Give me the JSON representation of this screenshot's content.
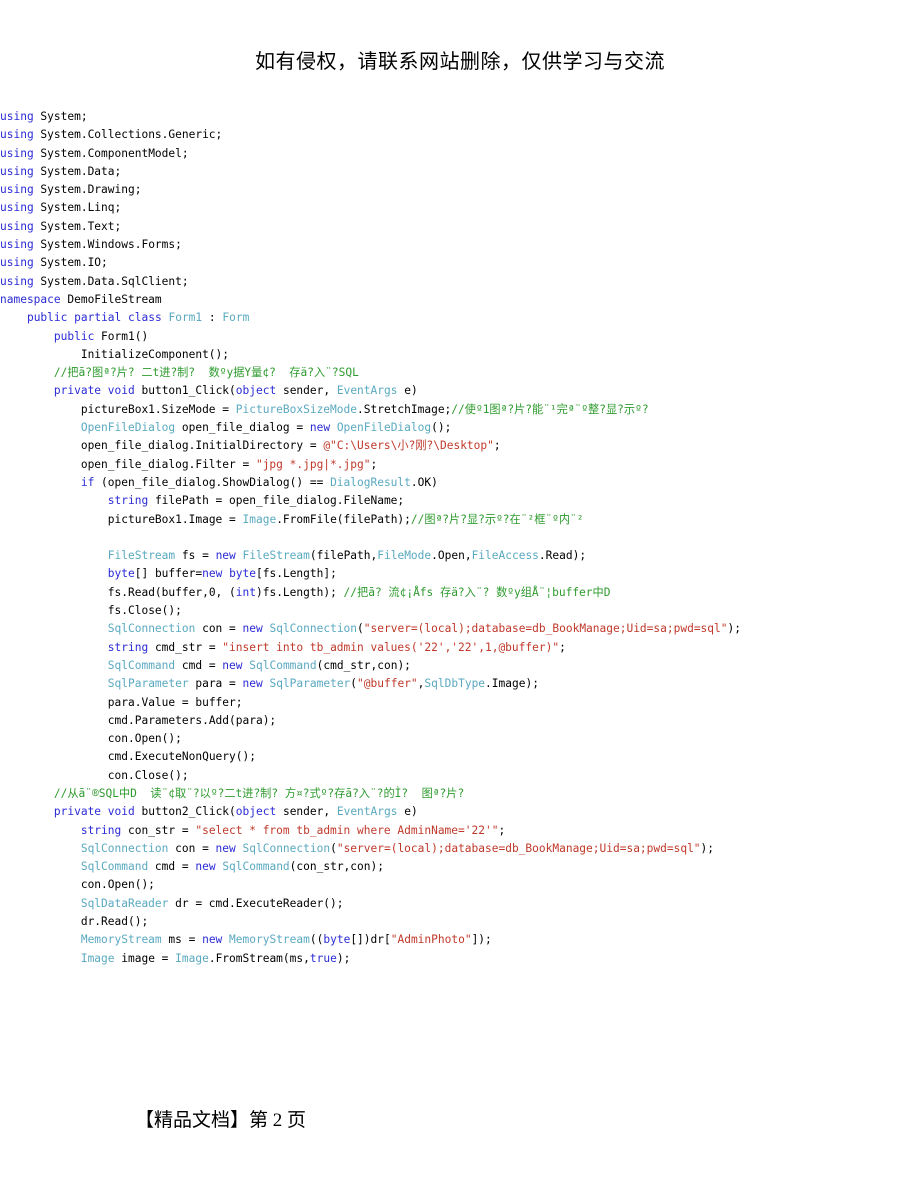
{
  "header": {
    "notice": "如有侵权，请联系网站删除，仅供学习与交流"
  },
  "footer": {
    "text": "【精品文档】第 2 页",
    "label": "【精品文档】",
    "page_prefix": "第",
    "page_number": "2",
    "page_suffix": "页"
  },
  "colors": {
    "keyword": "#2b2bd6",
    "type": "#5aa9c0",
    "string": "#c0392b",
    "comment": "#2e9b2e",
    "plain": "#000000",
    "background": "#ffffff"
  },
  "code": {
    "language": "C#",
    "lines": [
      {
        "id": "l1",
        "indent": "",
        "tokens": [
          {
            "t": "using",
            "c": "kw"
          },
          {
            "t": " System;",
            "c": "pln"
          }
        ]
      },
      {
        "id": "l2",
        "indent": "",
        "tokens": [
          {
            "t": "using",
            "c": "kw"
          },
          {
            "t": " System.Collections.Generic;",
            "c": "pln"
          }
        ]
      },
      {
        "id": "l3",
        "indent": "",
        "tokens": [
          {
            "t": "using",
            "c": "kw"
          },
          {
            "t": " System.ComponentModel;",
            "c": "pln"
          }
        ]
      },
      {
        "id": "l4",
        "indent": "",
        "tokens": [
          {
            "t": "using",
            "c": "kw"
          },
          {
            "t": " System.Data;",
            "c": "pln"
          }
        ]
      },
      {
        "id": "l5",
        "indent": "",
        "tokens": [
          {
            "t": "using",
            "c": "kw"
          },
          {
            "t": " System.Drawing;",
            "c": "pln"
          }
        ]
      },
      {
        "id": "l6",
        "indent": "",
        "tokens": [
          {
            "t": "using",
            "c": "kw"
          },
          {
            "t": " System.Linq;",
            "c": "pln"
          }
        ]
      },
      {
        "id": "l7",
        "indent": "",
        "tokens": [
          {
            "t": "using",
            "c": "kw"
          },
          {
            "t": " System.Text;",
            "c": "pln"
          }
        ]
      },
      {
        "id": "l8",
        "indent": "",
        "tokens": [
          {
            "t": "using",
            "c": "kw"
          },
          {
            "t": " System.Windows.Forms;",
            "c": "pln"
          }
        ]
      },
      {
        "id": "l9",
        "indent": "",
        "tokens": [
          {
            "t": "using",
            "c": "kw"
          },
          {
            "t": " System.IO;",
            "c": "pln"
          }
        ]
      },
      {
        "id": "l10",
        "indent": "",
        "tokens": [
          {
            "t": "using",
            "c": "kw"
          },
          {
            "t": " System.Data.SqlClient;",
            "c": "pln"
          }
        ]
      },
      {
        "id": "l11",
        "indent": "",
        "tokens": [
          {
            "t": "namespace",
            "c": "kw"
          },
          {
            "t": " DemoFileStream",
            "c": "pln"
          }
        ]
      },
      {
        "id": "l12",
        "indent": "    ",
        "tokens": [
          {
            "t": "public",
            "c": "kw"
          },
          {
            "t": " ",
            "c": "pln"
          },
          {
            "t": "partial",
            "c": "kw"
          },
          {
            "t": " ",
            "c": "pln"
          },
          {
            "t": "class",
            "c": "kw"
          },
          {
            "t": " ",
            "c": "pln"
          },
          {
            "t": "Form1",
            "c": "typ"
          },
          {
            "t": " : ",
            "c": "pln"
          },
          {
            "t": "Form",
            "c": "typ"
          }
        ]
      },
      {
        "id": "l13",
        "indent": "        ",
        "tokens": [
          {
            "t": "public",
            "c": "kw"
          },
          {
            "t": " Form1()",
            "c": "pln"
          }
        ]
      },
      {
        "id": "l14",
        "indent": "            ",
        "tokens": [
          {
            "t": "InitializeComponent();",
            "c": "pln"
          }
        ]
      },
      {
        "id": "l15",
        "indent": "        ",
        "tokens": [
          {
            "t": "//把ā?图ª?片? 二t进?制?  数ºy据Y量¢?  存ä?入¨?SQL",
            "c": "cmt"
          }
        ]
      },
      {
        "id": "l16",
        "indent": "        ",
        "tokens": [
          {
            "t": "private",
            "c": "kw"
          },
          {
            "t": " ",
            "c": "pln"
          },
          {
            "t": "void",
            "c": "kw"
          },
          {
            "t": " button1_Click(",
            "c": "pln"
          },
          {
            "t": "object",
            "c": "kw"
          },
          {
            "t": " sender, ",
            "c": "pln"
          },
          {
            "t": "EventArgs",
            "c": "typ"
          },
          {
            "t": " e)",
            "c": "pln"
          }
        ]
      },
      {
        "id": "l17",
        "indent": "            ",
        "tokens": [
          {
            "t": "pictureBox1.SizeMode = ",
            "c": "pln"
          },
          {
            "t": "PictureBoxSizeMode",
            "c": "typ"
          },
          {
            "t": ".StretchImage;",
            "c": "pln"
          },
          {
            "t": "//使º1图ª?片?能¨¹完ª¨º整?显?示º?",
            "c": "cmt"
          }
        ]
      },
      {
        "id": "l18",
        "indent": "            ",
        "tokens": [
          {
            "t": "OpenFileDialog",
            "c": "typ"
          },
          {
            "t": " open_file_dialog = ",
            "c": "pln"
          },
          {
            "t": "new",
            "c": "kw"
          },
          {
            "t": " ",
            "c": "pln"
          },
          {
            "t": "OpenFileDialog",
            "c": "typ"
          },
          {
            "t": "();",
            "c": "pln"
          }
        ]
      },
      {
        "id": "l19",
        "indent": "            ",
        "tokens": [
          {
            "t": "open_file_dialog.InitialDirectory = ",
            "c": "pln"
          },
          {
            "t": "@\"C:\\Users\\小?刚?\\Desktop\"",
            "c": "str"
          },
          {
            "t": ";",
            "c": "pln"
          }
        ]
      },
      {
        "id": "l20",
        "indent": "            ",
        "tokens": [
          {
            "t": "open_file_dialog.Filter = ",
            "c": "pln"
          },
          {
            "t": "\"jpg *.jpg|*.jpg\"",
            "c": "str"
          },
          {
            "t": ";",
            "c": "pln"
          }
        ]
      },
      {
        "id": "l21",
        "indent": "            ",
        "tokens": [
          {
            "t": "if",
            "c": "kw"
          },
          {
            "t": " (open_file_dialog.ShowDialog() == ",
            "c": "pln"
          },
          {
            "t": "DialogResult",
            "c": "typ"
          },
          {
            "t": ".OK)",
            "c": "pln"
          }
        ]
      },
      {
        "id": "l22",
        "indent": "                ",
        "tokens": [
          {
            "t": "string",
            "c": "kw"
          },
          {
            "t": " filePath = open_file_dialog.FileName;",
            "c": "pln"
          }
        ]
      },
      {
        "id": "l23",
        "indent": "                ",
        "tokens": [
          {
            "t": "pictureBox1.Image = ",
            "c": "pln"
          },
          {
            "t": "Image",
            "c": "typ"
          },
          {
            "t": ".FromFile(filePath);",
            "c": "pln"
          },
          {
            "t": "//图ª?片?显?示º?在¨²框¨º内¨²",
            "c": "cmt"
          }
        ]
      },
      {
        "id": "l24",
        "indent": "                ",
        "tokens": [
          {
            "t": "",
            "c": "pln"
          }
        ]
      },
      {
        "id": "l25",
        "indent": "                ",
        "tokens": [
          {
            "t": "FileStream",
            "c": "typ"
          },
          {
            "t": " fs = ",
            "c": "pln"
          },
          {
            "t": "new",
            "c": "kw"
          },
          {
            "t": " ",
            "c": "pln"
          },
          {
            "t": "FileStream",
            "c": "typ"
          },
          {
            "t": "(filePath,",
            "c": "pln"
          },
          {
            "t": "FileMode",
            "c": "typ"
          },
          {
            "t": ".Open,",
            "c": "pln"
          },
          {
            "t": "FileAccess",
            "c": "typ"
          },
          {
            "t": ".Read);",
            "c": "pln"
          }
        ]
      },
      {
        "id": "l26",
        "indent": "                ",
        "tokens": [
          {
            "t": "byte",
            "c": "kw"
          },
          {
            "t": "[] buffer=",
            "c": "pln"
          },
          {
            "t": "new",
            "c": "kw"
          },
          {
            "t": " ",
            "c": "pln"
          },
          {
            "t": "byte",
            "c": "kw"
          },
          {
            "t": "[fs.Length];",
            "c": "pln"
          }
        ]
      },
      {
        "id": "l27",
        "indent": "                ",
        "tokens": [
          {
            "t": "fs.Read(buffer,0, (",
            "c": "pln"
          },
          {
            "t": "int",
            "c": "kw"
          },
          {
            "t": ")fs.Length); ",
            "c": "pln"
          },
          {
            "t": "//把ā? 流¢¡Åfs 存ä?入¨? 数ºy组Å¨¦buffer中D",
            "c": "cmt"
          }
        ]
      },
      {
        "id": "l28",
        "indent": "                ",
        "tokens": [
          {
            "t": "fs.Close();",
            "c": "pln"
          }
        ]
      },
      {
        "id": "l29",
        "indent": "                ",
        "tokens": [
          {
            "t": "SqlConnection",
            "c": "typ"
          },
          {
            "t": " con = ",
            "c": "pln"
          },
          {
            "t": "new",
            "c": "kw"
          },
          {
            "t": " ",
            "c": "pln"
          },
          {
            "t": "SqlConnection",
            "c": "typ"
          },
          {
            "t": "(",
            "c": "pln"
          },
          {
            "t": "\"server=(local);database=db_BookManage;Uid=sa;pwd=sql\"",
            "c": "str"
          },
          {
            "t": ");",
            "c": "pln"
          }
        ]
      },
      {
        "id": "l30",
        "indent": "                ",
        "tokens": [
          {
            "t": "string",
            "c": "kw"
          },
          {
            "t": " cmd_str = ",
            "c": "pln"
          },
          {
            "t": "\"insert into tb_admin values('22','22',1,@buffer)\"",
            "c": "str"
          },
          {
            "t": ";",
            "c": "pln"
          }
        ]
      },
      {
        "id": "l31",
        "indent": "                ",
        "tokens": [
          {
            "t": "SqlCommand",
            "c": "typ"
          },
          {
            "t": " cmd = ",
            "c": "pln"
          },
          {
            "t": "new",
            "c": "kw"
          },
          {
            "t": " ",
            "c": "pln"
          },
          {
            "t": "SqlCommand",
            "c": "typ"
          },
          {
            "t": "(cmd_str,con);",
            "c": "pln"
          }
        ]
      },
      {
        "id": "l32",
        "indent": "                ",
        "tokens": [
          {
            "t": "SqlParameter",
            "c": "typ"
          },
          {
            "t": " para = ",
            "c": "pln"
          },
          {
            "t": "new",
            "c": "kw"
          },
          {
            "t": " ",
            "c": "pln"
          },
          {
            "t": "SqlParameter",
            "c": "typ"
          },
          {
            "t": "(",
            "c": "pln"
          },
          {
            "t": "\"@buffer\"",
            "c": "str"
          },
          {
            "t": ",",
            "c": "pln"
          },
          {
            "t": "SqlDbType",
            "c": "typ"
          },
          {
            "t": ".Image);",
            "c": "pln"
          }
        ]
      },
      {
        "id": "l33",
        "indent": "                ",
        "tokens": [
          {
            "t": "para.Value = buffer;",
            "c": "pln"
          }
        ]
      },
      {
        "id": "l34",
        "indent": "                ",
        "tokens": [
          {
            "t": "cmd.Parameters.Add(para);",
            "c": "pln"
          }
        ]
      },
      {
        "id": "l35",
        "indent": "                ",
        "tokens": [
          {
            "t": "con.Open();",
            "c": "pln"
          }
        ]
      },
      {
        "id": "l36",
        "indent": "                ",
        "tokens": [
          {
            "t": "cmd.ExecuteNonQuery();",
            "c": "pln"
          }
        ]
      },
      {
        "id": "l37",
        "indent": "                ",
        "tokens": [
          {
            "t": "con.Close();",
            "c": "pln"
          }
        ]
      },
      {
        "id": "l38",
        "indent": "        ",
        "tokens": [
          {
            "t": "//从ā¨®SQL中D  读¨¢取¨?以º?二t进?制? 方¤?式º?存ā?入¨?的Ì?  图ª?片?",
            "c": "cmt"
          }
        ]
      },
      {
        "id": "l39",
        "indent": "        ",
        "tokens": [
          {
            "t": "private",
            "c": "kw"
          },
          {
            "t": " ",
            "c": "pln"
          },
          {
            "t": "void",
            "c": "kw"
          },
          {
            "t": " button2_Click(",
            "c": "pln"
          },
          {
            "t": "object",
            "c": "kw"
          },
          {
            "t": " sender, ",
            "c": "pln"
          },
          {
            "t": "EventArgs",
            "c": "typ"
          },
          {
            "t": " e)",
            "c": "pln"
          }
        ]
      },
      {
        "id": "l40",
        "indent": "            ",
        "tokens": [
          {
            "t": "string",
            "c": "kw"
          },
          {
            "t": " con_str = ",
            "c": "pln"
          },
          {
            "t": "\"select * from tb_admin where AdminName='22'\"",
            "c": "str"
          },
          {
            "t": ";",
            "c": "pln"
          }
        ]
      },
      {
        "id": "l41",
        "indent": "            ",
        "tokens": [
          {
            "t": "SqlConnection",
            "c": "typ"
          },
          {
            "t": " con = ",
            "c": "pln"
          },
          {
            "t": "new",
            "c": "kw"
          },
          {
            "t": " ",
            "c": "pln"
          },
          {
            "t": "SqlConnection",
            "c": "typ"
          },
          {
            "t": "(",
            "c": "pln"
          },
          {
            "t": "\"server=(local);database=db_BookManage;Uid=sa;pwd=sql\"",
            "c": "str"
          },
          {
            "t": ");",
            "c": "pln"
          }
        ]
      },
      {
        "id": "l42",
        "indent": "            ",
        "tokens": [
          {
            "t": "SqlCommand",
            "c": "typ"
          },
          {
            "t": " cmd = ",
            "c": "pln"
          },
          {
            "t": "new",
            "c": "kw"
          },
          {
            "t": " ",
            "c": "pln"
          },
          {
            "t": "SqlCommand",
            "c": "typ"
          },
          {
            "t": "(con_str,con);",
            "c": "pln"
          }
        ]
      },
      {
        "id": "l43",
        "indent": "            ",
        "tokens": [
          {
            "t": "con.Open();",
            "c": "pln"
          }
        ]
      },
      {
        "id": "l44",
        "indent": "            ",
        "tokens": [
          {
            "t": "SqlDataReader",
            "c": "typ"
          },
          {
            "t": " dr = cmd.ExecuteReader();",
            "c": "pln"
          }
        ]
      },
      {
        "id": "l45",
        "indent": "            ",
        "tokens": [
          {
            "t": "dr.Read();",
            "c": "pln"
          }
        ]
      },
      {
        "id": "l46",
        "indent": "            ",
        "tokens": [
          {
            "t": "MemoryStream",
            "c": "typ"
          },
          {
            "t": " ms = ",
            "c": "pln"
          },
          {
            "t": "new",
            "c": "kw"
          },
          {
            "t": " ",
            "c": "pln"
          },
          {
            "t": "MemoryStream",
            "c": "typ"
          },
          {
            "t": "((",
            "c": "pln"
          },
          {
            "t": "byte",
            "c": "kw"
          },
          {
            "t": "[])dr[",
            "c": "pln"
          },
          {
            "t": "\"AdminPhoto\"",
            "c": "str"
          },
          {
            "t": "]);",
            "c": "pln"
          }
        ]
      },
      {
        "id": "l47",
        "indent": "            ",
        "tokens": [
          {
            "t": "Image",
            "c": "typ"
          },
          {
            "t": " image = ",
            "c": "pln"
          },
          {
            "t": "Image",
            "c": "typ"
          },
          {
            "t": ".FromStream(ms,",
            "c": "pln"
          },
          {
            "t": "true",
            "c": "kw"
          },
          {
            "t": ");",
            "c": "pln"
          }
        ]
      }
    ]
  }
}
